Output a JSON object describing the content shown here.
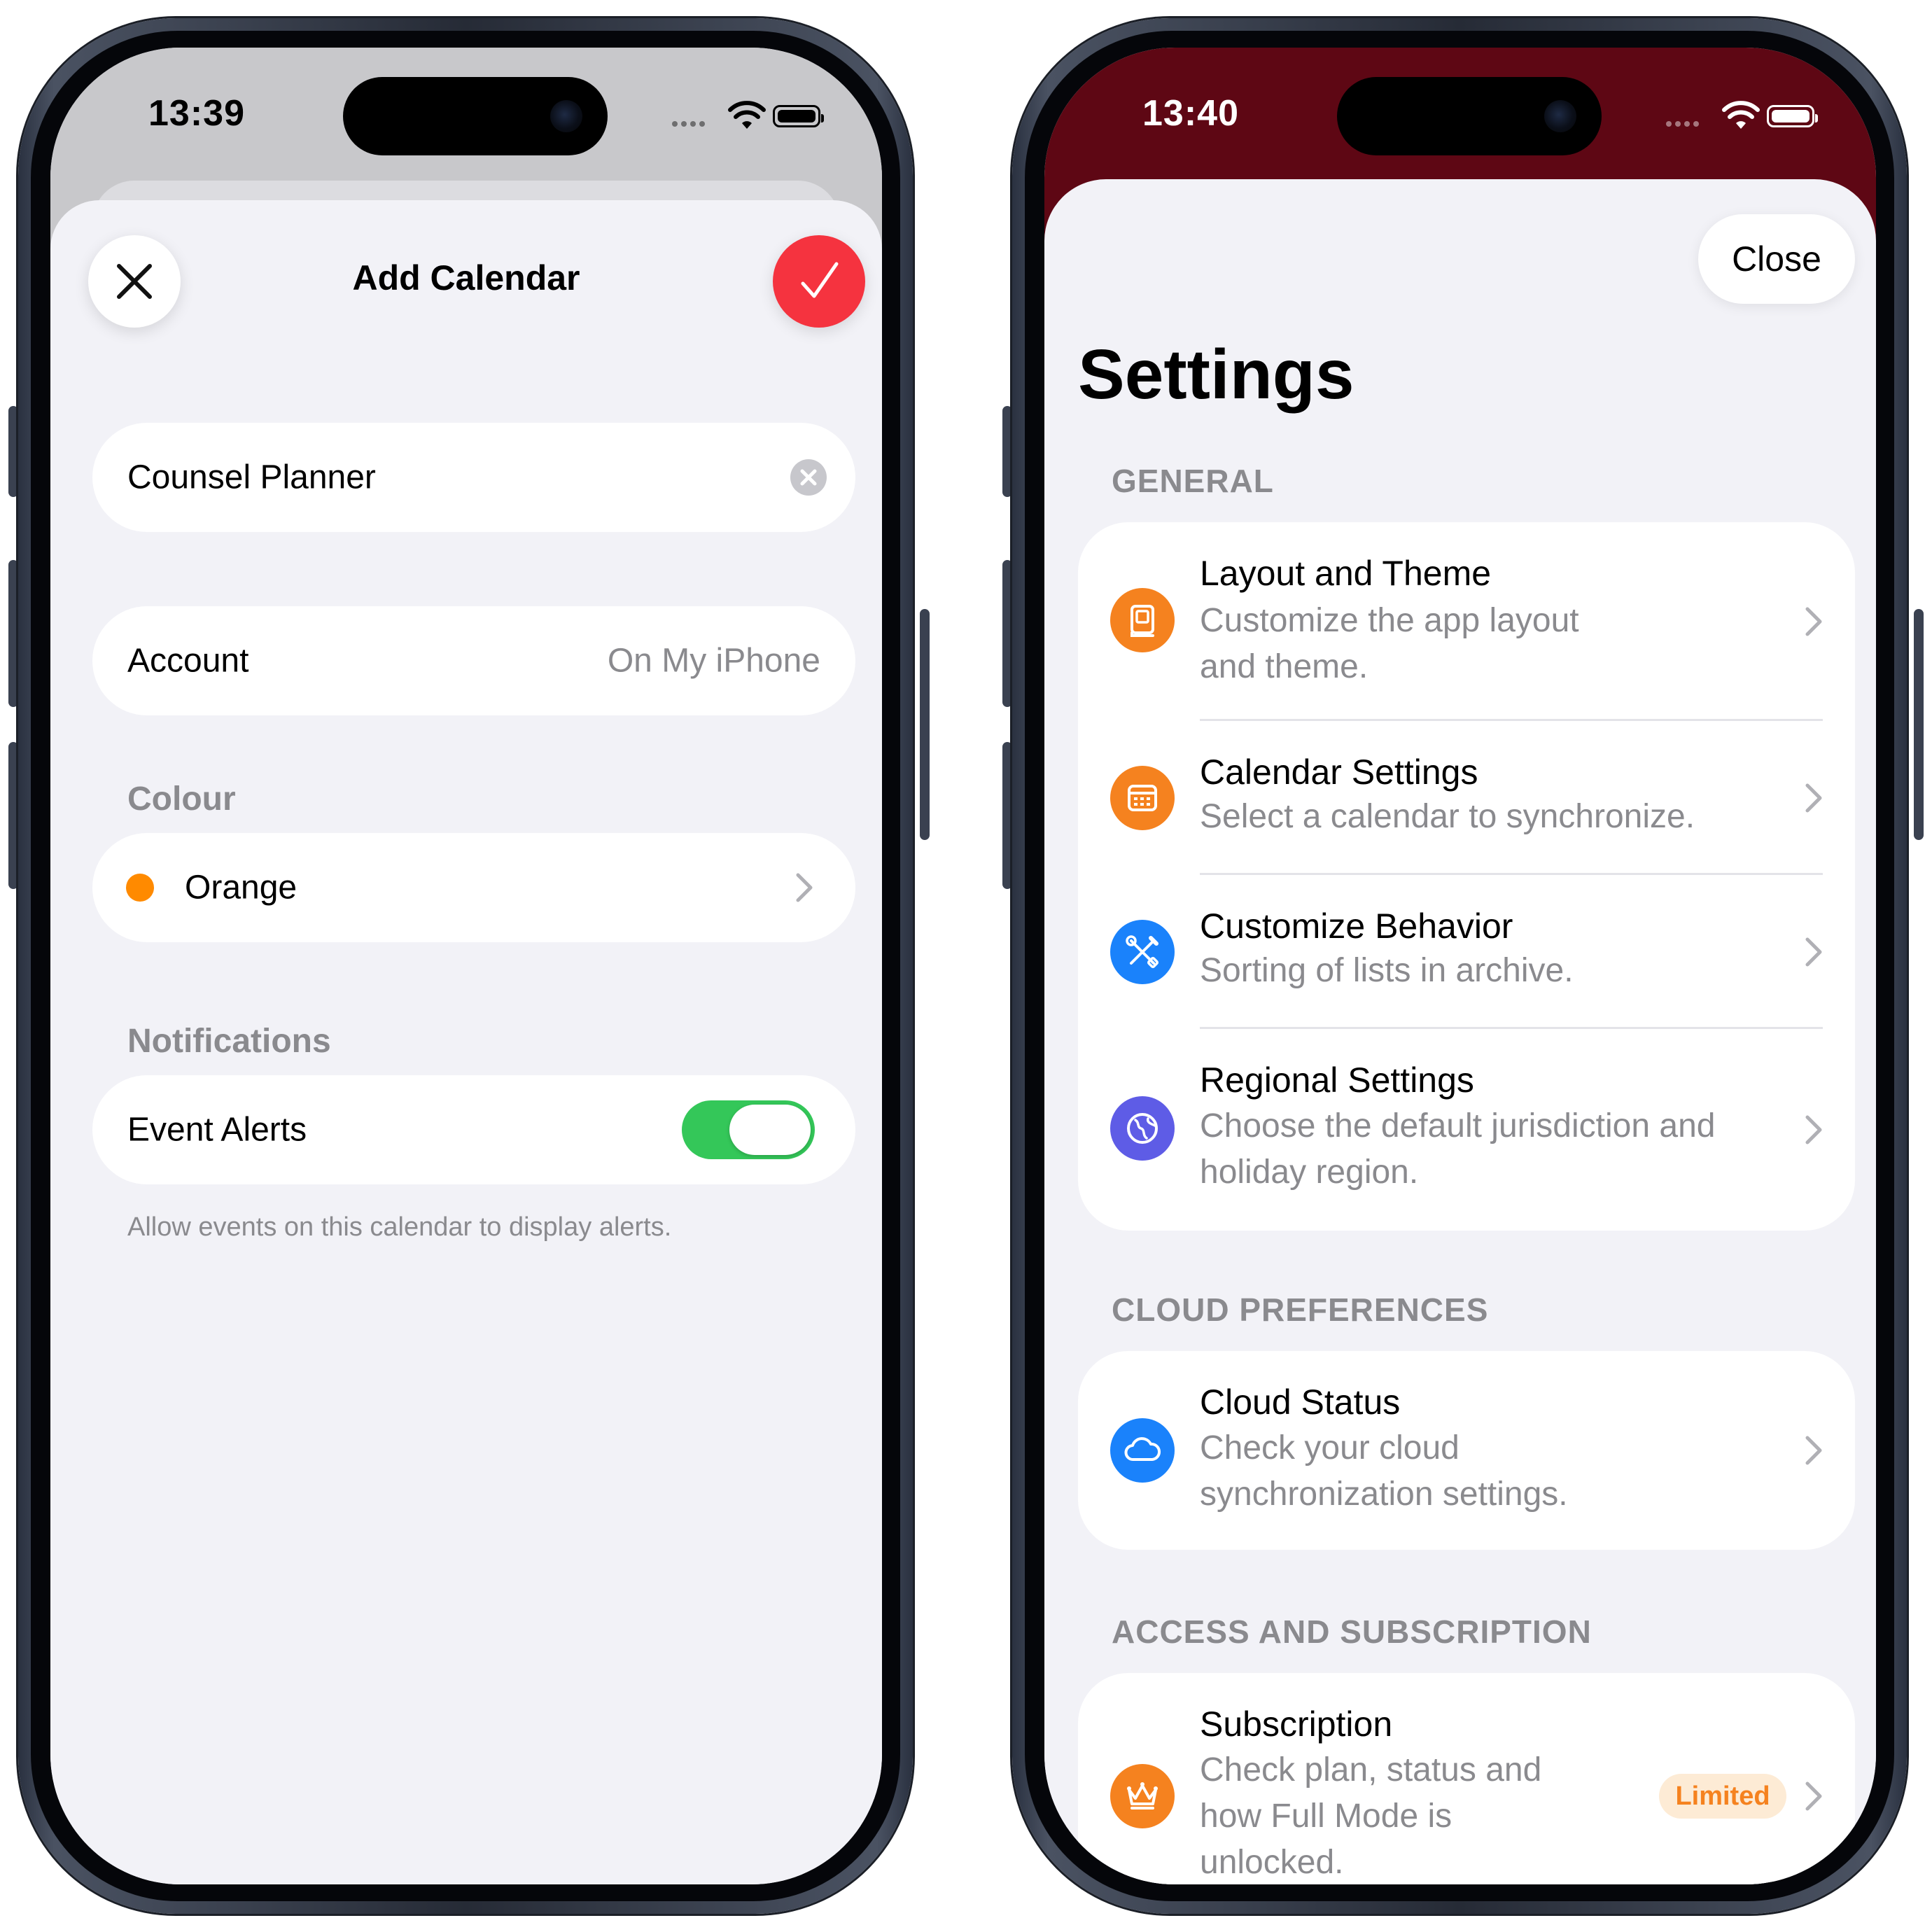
{
  "left_phone": {
    "status_bar": {
      "time": "13:39"
    },
    "header": {
      "title": "Add Calendar"
    },
    "name_field": {
      "value": "Counsel Planner"
    },
    "account": {
      "label": "Account",
      "value": "On My iPhone"
    },
    "colour_section": {
      "header": "Colour",
      "value": "Orange",
      "dot_color": "#ff8a00"
    },
    "notifications_section": {
      "header": "Notifications",
      "event_alerts_label": "Event Alerts",
      "event_alerts_on": true,
      "footnote": "Allow events on this calendar to display alerts."
    },
    "colors": {
      "confirm": "#f5333f",
      "toggle_on": "#34c759"
    }
  },
  "right_phone": {
    "status_bar": {
      "time": "13:40"
    },
    "close_label": "Close",
    "title": "Settings",
    "sections": [
      {
        "header": "GENERAL",
        "items": [
          {
            "title": "Layout and Theme",
            "subtitle_lines": [
              "Customize the app layout",
              "and theme."
            ],
            "icon": "book-icon",
            "icon_color": "#f5821f"
          },
          {
            "title": "Calendar Settings",
            "subtitle_lines": [
              "Select a calendar to synchronize."
            ],
            "icon": "calendar-icon",
            "icon_color": "#f5821f"
          },
          {
            "title": "Customize Behavior",
            "subtitle_lines": [
              "Sorting of lists in archive."
            ],
            "icon": "tools-icon",
            "icon_color": "#1a82fb"
          },
          {
            "title": "Regional Settings",
            "subtitle_lines": [
              "Choose the default jurisdiction and",
              "holiday region."
            ],
            "icon": "globe-icon",
            "icon_color": "#5e5ce6"
          }
        ]
      },
      {
        "header": "CLOUD PREFERENCES",
        "items": [
          {
            "title": "Cloud Status",
            "subtitle_lines": [
              "Check your cloud",
              "synchronization settings."
            ],
            "icon": "cloud-icon",
            "icon_color": "#1a82fb"
          }
        ]
      },
      {
        "header": "ACCESS AND SUBSCRIPTION",
        "items": [
          {
            "title": "Subscription",
            "subtitle_lines": [
              "Check plan, status and",
              "how Full Mode is",
              "unlocked."
            ],
            "icon": "crown-icon",
            "icon_color": "#f5821f",
            "badge": "Limited"
          }
        ]
      }
    ],
    "colors": {
      "header_bg": "#5e0714",
      "badge_bg": "#fdebd5",
      "badge_text": "#f5821f"
    }
  }
}
